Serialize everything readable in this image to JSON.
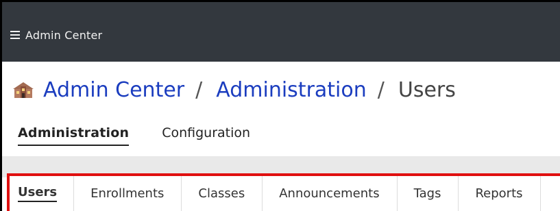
{
  "topbar": {
    "title": "Admin Center",
    "menu_icon": "hamburger-menu-icon"
  },
  "breadcrumb": {
    "icon": "school-building-icon",
    "items": [
      "Admin Center",
      "Administration",
      "Users"
    ],
    "separator": "/"
  },
  "subnav": {
    "items": [
      "Administration",
      "Configuration"
    ],
    "active": "Administration"
  },
  "tabs": {
    "items": [
      "Users",
      "Enrollments",
      "Classes",
      "Announcements",
      "Tags",
      "Reports"
    ],
    "active": "Users"
  },
  "colors": {
    "topbar_bg": "#33383e",
    "link": "#1b3dbf",
    "highlight_border": "#e01010"
  }
}
